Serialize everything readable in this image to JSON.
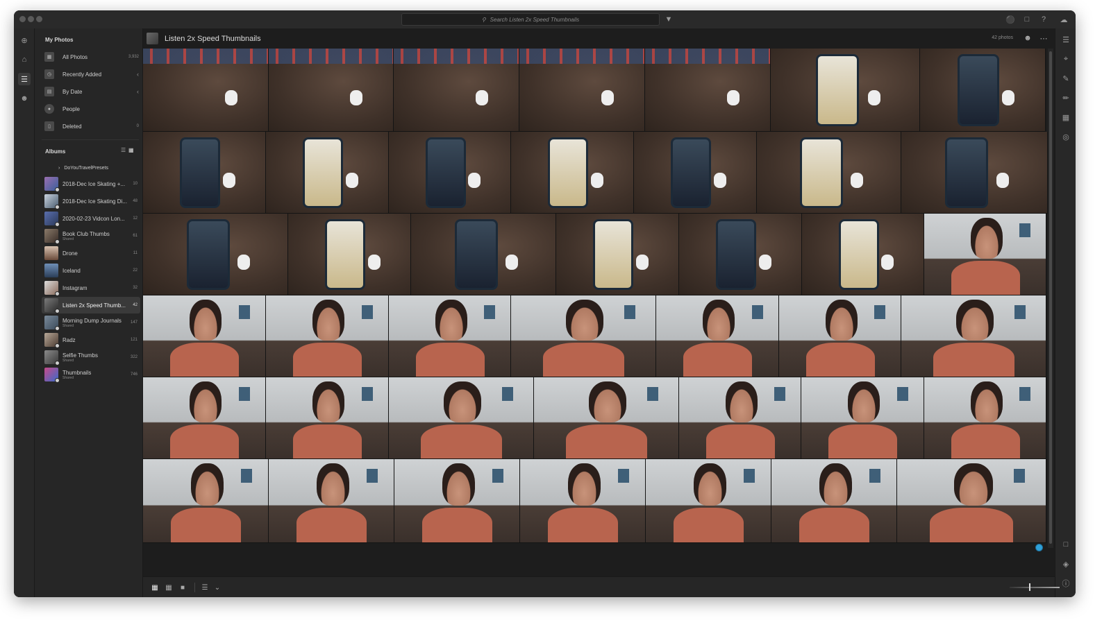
{
  "topbar": {
    "search_placeholder": "Search Listen 2x Speed Thumbnails"
  },
  "sidebar": {
    "my_photos_heading": "My Photos",
    "nav": [
      {
        "label": "All Photos",
        "count": "3,932",
        "icon": "photos-icon"
      },
      {
        "label": "Recently Added",
        "count": "‹",
        "icon": "clock-icon"
      },
      {
        "label": "By Date",
        "count": "‹",
        "icon": "calendar-icon"
      },
      {
        "label": "People",
        "count": "",
        "icon": "person-icon"
      },
      {
        "label": "Deleted",
        "count": "0",
        "icon": "trash-icon"
      }
    ],
    "albums_heading": "Albums",
    "folder": "DoYouTravelPresets",
    "albums": [
      {
        "name": "2018-Dec Ice Skating +...",
        "sub": "",
        "count": "10"
      },
      {
        "name": "2018-Dec Ice Skating Di...",
        "sub": "",
        "count": "48"
      },
      {
        "name": "2020-02-23 Vidcon Lon...",
        "sub": "",
        "count": "12"
      },
      {
        "name": "Book Club Thumbs",
        "sub": "Shared",
        "count": "61"
      },
      {
        "name": "Drone",
        "sub": "",
        "count": "11"
      },
      {
        "name": "Iceland",
        "sub": "",
        "count": "22"
      },
      {
        "name": "Instagram",
        "sub": "",
        "count": "32"
      },
      {
        "name": "Listen 2x Speed Thumb...",
        "sub": "",
        "count": "42"
      },
      {
        "name": "Morning Dump Journals",
        "sub": "Shared",
        "count": "147"
      },
      {
        "name": "Radz",
        "sub": "",
        "count": "121"
      },
      {
        "name": "Selfie Thumbs",
        "sub": "Shared",
        "count": "322"
      },
      {
        "name": "Thumbnails",
        "sub": "Shared",
        "count": "746"
      }
    ]
  },
  "main": {
    "album_title": "Listen 2x Speed Thumbnails",
    "photo_count": "42 photos"
  },
  "colors": {
    "accent": "#2fa0d8",
    "background": "#1d1d1d",
    "panel": "#262626"
  }
}
